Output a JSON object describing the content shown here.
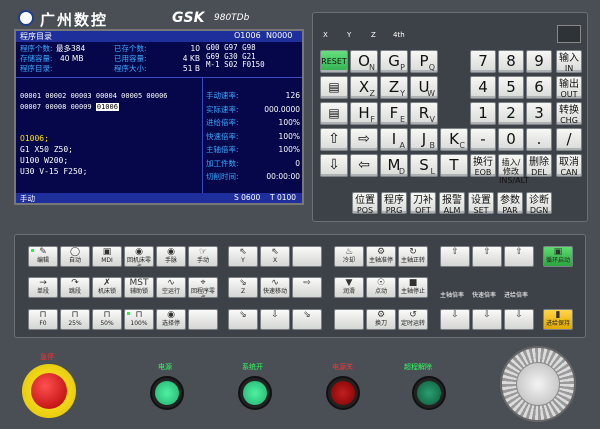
{
  "brand": {
    "name": "广州数控",
    "logo": "GSK",
    "model": "980TDb"
  },
  "screen": {
    "title": "程序目录",
    "prog_no": "O1006",
    "seq_no": "N0000",
    "info": [
      {
        "label": "程序个数:",
        "value": "最多384",
        "label2": "已存个数:",
        "value2": "10"
      },
      {
        "label": "存储容量:",
        "value": "40 MB",
        "label2": "已用容量:",
        "value2": "4 KB"
      },
      {
        "label": "程序目录:",
        "value": "",
        "label2": "程序大小:",
        "value2": "51 B"
      }
    ],
    "modal": [
      [
        "G00",
        "G97",
        "G98"
      ],
      [
        "G69",
        "G30",
        "G21"
      ],
      [
        "M-1",
        "S02",
        "F0150"
      ]
    ],
    "programs_row1": "00001 00002 00003 00004 00005 00006",
    "programs_row2": "00007 00008 00009",
    "selected_program": "01006",
    "code": [
      "O1006;",
      "G1 X50 Z50;",
      "U100 W200;",
      "U30 V-15 F250;"
    ],
    "status": [
      {
        "label": "手动速率:",
        "value": "126"
      },
      {
        "label": "实际速率:",
        "value": "000.0000"
      },
      {
        "label": "进给倍率:",
        "value": "100%"
      },
      {
        "label": "快速倍率:",
        "value": "100%"
      },
      {
        "label": "主轴倍率:",
        "value": "100%"
      },
      {
        "label": "加工件数:",
        "value": "0"
      },
      {
        "label": "切削时间:",
        "value": "00:00:00"
      }
    ],
    "mode": "手动",
    "spindle": "S 0600",
    "tool": "T 0100"
  },
  "axis_indicators": [
    "X",
    "Y",
    "Z",
    "4th"
  ],
  "keypad": {
    "reset": "RESET",
    "row1": [
      {
        "k": "O",
        "s": "N"
      },
      {
        "k": "G",
        "s": "P"
      },
      {
        "k": "P",
        "s": "Q"
      }
    ],
    "row2": [
      {
        "k": "X",
        "s": "Z"
      },
      {
        "k": "Z",
        "s": "Y"
      },
      {
        "k": "U",
        "s": "W"
      }
    ],
    "row3": [
      {
        "k": "H",
        "s": "F"
      },
      {
        "k": "F",
        "s": "E"
      },
      {
        "k": "R",
        "s": "V"
      }
    ],
    "row4": [
      {
        "k": "I",
        "s": "A"
      },
      {
        "k": "J",
        "s": "B"
      },
      {
        "k": "K",
        "s": "C"
      }
    ],
    "row5": [
      {
        "k": "M",
        "s": "D"
      },
      {
        "k": "S",
        "s": "L"
      },
      {
        "k": "T",
        "s": ""
      }
    ],
    "nums": [
      [
        "7",
        "8",
        "9"
      ],
      [
        "4",
        "5",
        "6"
      ],
      [
        "1",
        "2",
        "3"
      ],
      [
        "-",
        "0",
        "."
      ]
    ],
    "row4_extra": [
      "/",
      "#"
    ],
    "right": [
      {
        "zh": "输入",
        "en": "IN"
      },
      {
        "zh": "输出",
        "en": "OUT"
      },
      {
        "zh": "转换",
        "en": "CHG"
      },
      {
        "zh": "取消",
        "en": "CAN"
      }
    ],
    "edit": [
      {
        "zh": "换行",
        "en": "EOB"
      },
      {
        "zh": "插入/修改",
        "en": "INS/ALT"
      },
      {
        "zh": "删除",
        "en": "DEL"
      }
    ],
    "pages": [
      {
        "zh": "位置",
        "en": "POS"
      },
      {
        "zh": "程序",
        "en": "PRG"
      },
      {
        "zh": "刀补",
        "en": "OFT"
      },
      {
        "zh": "报警",
        "en": "ALM"
      },
      {
        "zh": "设置",
        "en": "SET"
      },
      {
        "zh": "参数",
        "en": "PAR"
      },
      {
        "zh": "诊断",
        "en": "DGN"
      }
    ]
  },
  "machine": {
    "g1": [
      [
        "编辑",
        "自动",
        "MDI",
        "回机床零点",
        "手脉"
      ],
      [
        "单段",
        "跳段",
        "机床锁",
        "辅助锁",
        "空运行"
      ],
      [
        "F0",
        "25%",
        "50%",
        "100%"
      ]
    ],
    "g1b": [
      "手动",
      "回程序零点",
      "选择停"
    ],
    "g2": [
      [
        "Y",
        "X"
      ],
      [
        "Z",
        "快速移动"
      ]
    ],
    "g3": [
      [
        "冷却",
        "主轴准停",
        "主轴正转"
      ],
      [
        "润滑",
        "点动",
        "主轴停止"
      ],
      [
        "",
        "换刀",
        "定时运转"
      ]
    ],
    "overrides": [
      "主轴倍率",
      "快速倍率",
      "进给倍率"
    ],
    "feed_hold": "循环启动",
    "cycle_pause": "进给保持"
  },
  "bottom": {
    "estop": "急停",
    "power_on": "电源",
    "system_on": "系统开",
    "power_off": "电源关",
    "overtravel": "超程解除"
  }
}
